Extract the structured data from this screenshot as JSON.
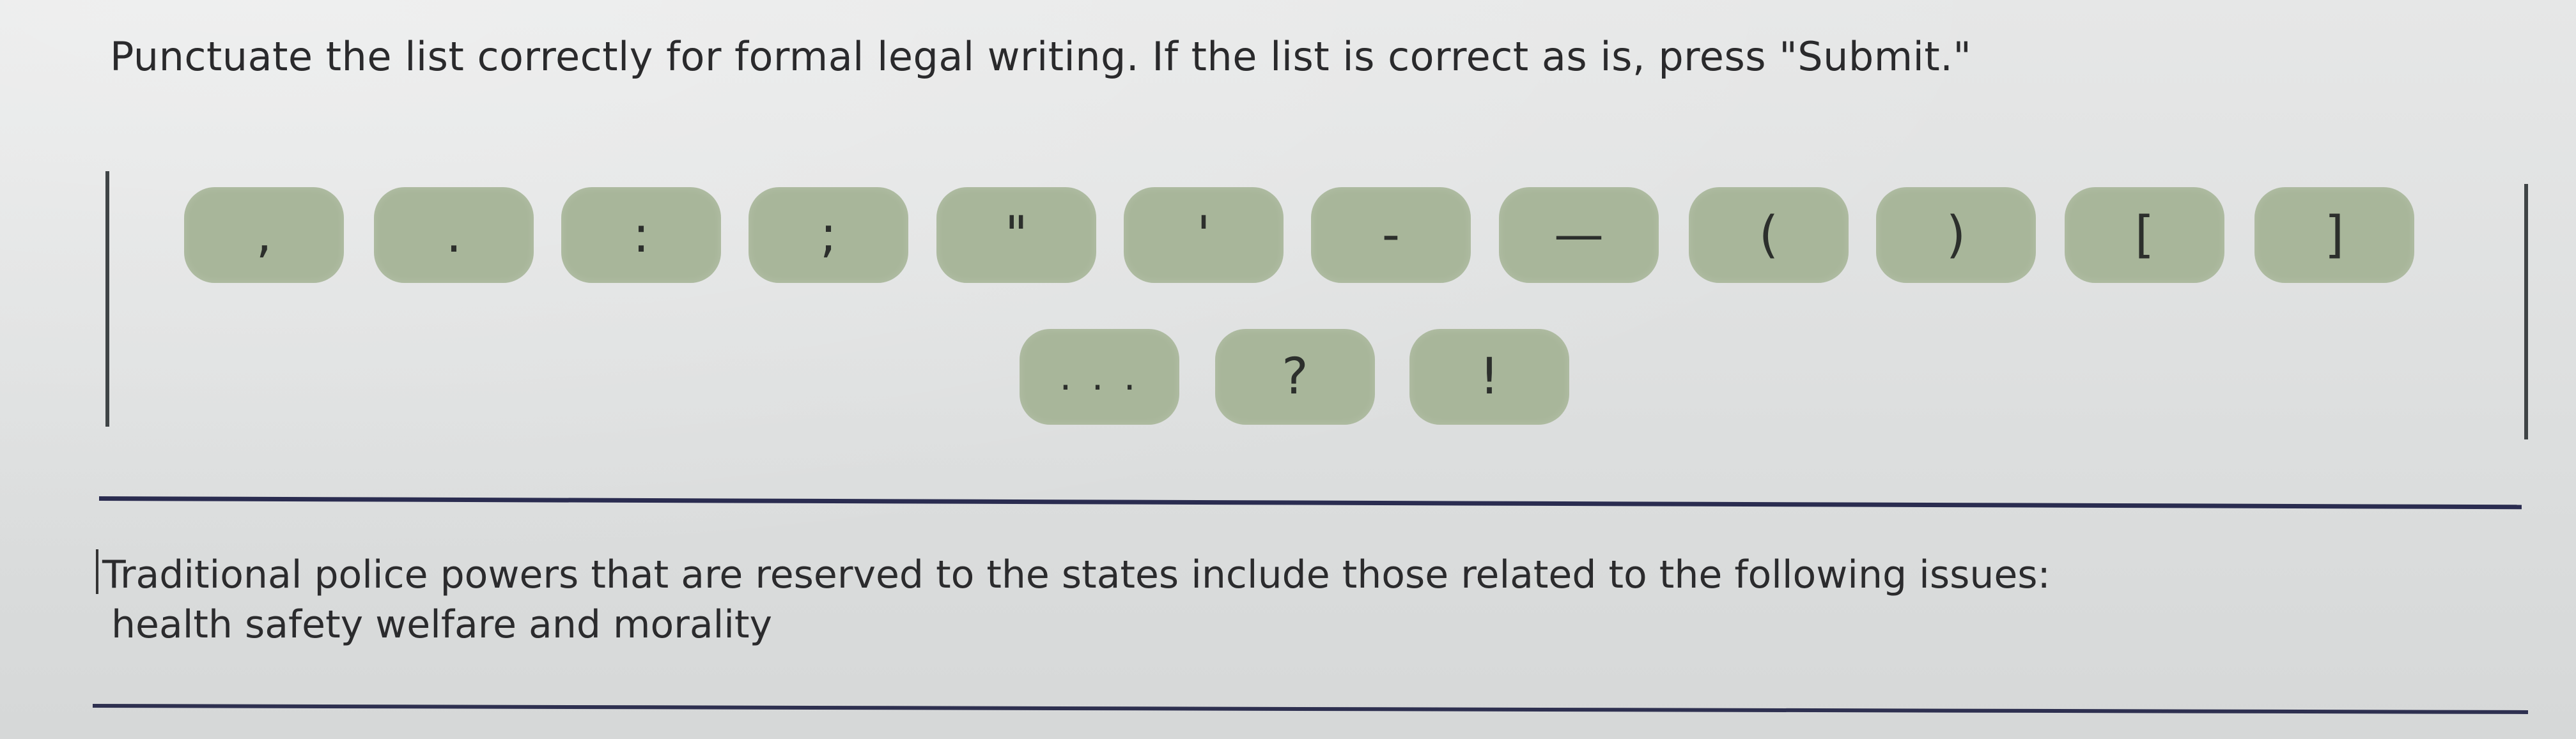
{
  "instruction": "Punctuate the list correctly for formal legal writing. If the list is correct as is, press \"Submit.\"",
  "palette": {
    "row1": [
      ",",
      ".",
      ":",
      ";",
      "\"",
      "'",
      "-",
      "—",
      "(",
      ")",
      "[",
      "]"
    ],
    "row2": [
      ". . .",
      "?",
      "!"
    ]
  },
  "sentence": {
    "line1": "Traditional police powers that are reserved to the states include those related to the following issues:",
    "line2": "health safety welfare and morality"
  }
}
